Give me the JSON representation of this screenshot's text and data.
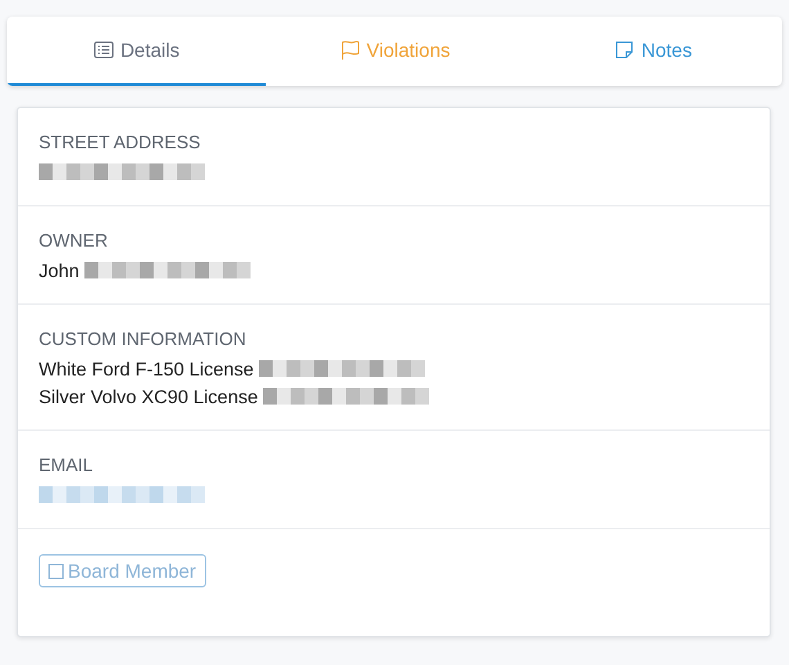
{
  "tabs": [
    {
      "label": "Details",
      "color": "#6b7280",
      "selected": true
    },
    {
      "label": "Violations",
      "color": "#f0a43a",
      "selected": false
    },
    {
      "label": "Notes",
      "color": "#3a97d6",
      "selected": false
    }
  ],
  "sections": [
    {
      "label": "STREET ADDRESS",
      "lines": [
        {
          "redacted": true,
          "kind": "plain"
        }
      ]
    },
    {
      "label": "OWNER",
      "lines": [
        {
          "text": "John",
          "redacted": true,
          "kind": "plain"
        }
      ]
    },
    {
      "label": "CUSTOM INFORMATION",
      "lines": [
        {
          "text": "White Ford F-150 License",
          "redacted": true,
          "kind": "plain"
        },
        {
          "text": "Silver Volvo XC90 License",
          "redacted": true,
          "kind": "plain"
        }
      ]
    },
    {
      "label": "EMAIL",
      "lines": [
        {
          "redacted": true,
          "kind": "email"
        }
      ]
    }
  ],
  "toggle": {
    "label": "Board Member",
    "checked": false
  }
}
